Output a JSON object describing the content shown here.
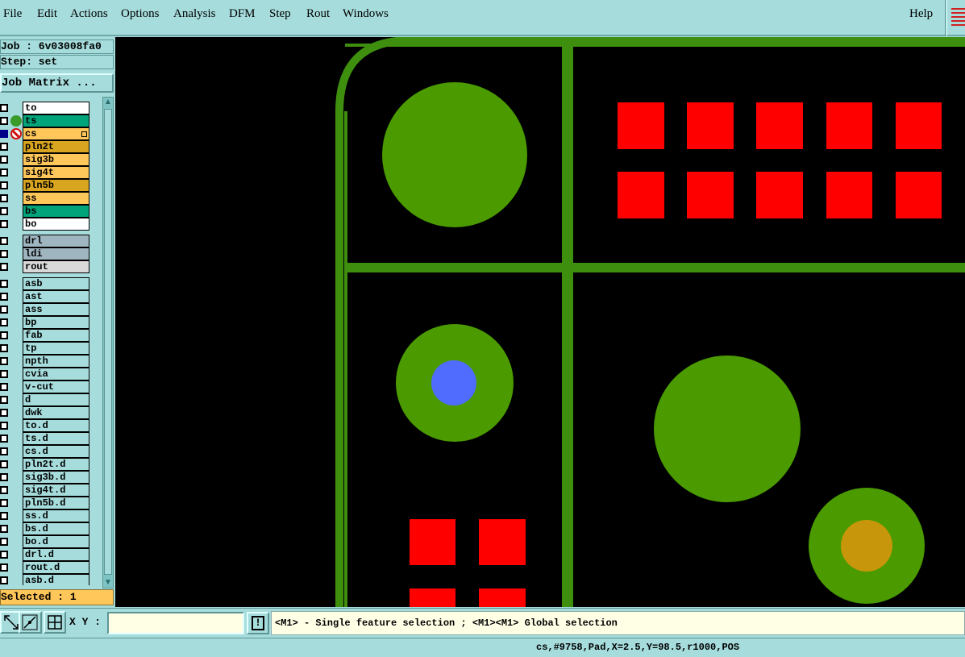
{
  "menu": {
    "file": "File",
    "edit": "Edit",
    "actions": "Actions",
    "options": "Options",
    "analysis": "Analysis",
    "dfm": "DFM",
    "step": "Step",
    "rout": "Rout",
    "windows": "Windows",
    "help": "Help"
  },
  "panel": {
    "job": "Job : 6v03008fa0",
    "step": "Step: set",
    "job_matrix": "Job Matrix ...",
    "selected": "Selected : 1"
  },
  "layers": [
    {
      "name": "to",
      "color": "#ffffff",
      "state": "none"
    },
    {
      "name": "ts",
      "color": "#00a47a",
      "state": "displayed"
    },
    {
      "name": "cs",
      "color": "#ffc659",
      "state": "work"
    },
    {
      "name": "pln2t",
      "color": "#d9a520",
      "state": "none"
    },
    {
      "name": "sig3b",
      "color": "#ffc659",
      "state": "none"
    },
    {
      "name": "sig4t",
      "color": "#ffc659",
      "state": "none"
    },
    {
      "name": "pln5b",
      "color": "#d9a520",
      "state": "none"
    },
    {
      "name": "ss",
      "color": "#ffc659",
      "state": "none"
    },
    {
      "name": "bs",
      "color": "#00a47a",
      "state": "none"
    },
    {
      "name": "bo",
      "color": "#ffffff",
      "state": "none"
    },
    {
      "name": "drl",
      "color": "#9fb5c0",
      "state": "none"
    },
    {
      "name": "ldi",
      "color": "#9fb5c0",
      "state": "none"
    },
    {
      "name": "rout",
      "color": "#d9d9d9",
      "state": "none"
    },
    {
      "name": "asb",
      "color": "#a6dcdc",
      "state": "none"
    },
    {
      "name": "ast",
      "color": "#a6dcdc",
      "state": "none"
    },
    {
      "name": "ass",
      "color": "#a6dcdc",
      "state": "none"
    },
    {
      "name": "bp",
      "color": "#a6dcdc",
      "state": "none"
    },
    {
      "name": "fab",
      "color": "#a6dcdc",
      "state": "none"
    },
    {
      "name": "tp",
      "color": "#a6dcdc",
      "state": "none"
    },
    {
      "name": "npth",
      "color": "#a6dcdc",
      "state": "none"
    },
    {
      "name": "cvia",
      "color": "#a6dcdc",
      "state": "none"
    },
    {
      "name": "v-cut",
      "color": "#a6dcdc",
      "state": "none"
    },
    {
      "name": "d",
      "color": "#a6dcdc",
      "state": "none"
    },
    {
      "name": "dwk",
      "color": "#a6dcdc",
      "state": "none"
    },
    {
      "name": "to.d",
      "color": "#a6dcdc",
      "state": "none"
    },
    {
      "name": "ts.d",
      "color": "#a6dcdc",
      "state": "none"
    },
    {
      "name": "cs.d",
      "color": "#a6dcdc",
      "state": "none"
    },
    {
      "name": "pln2t.d",
      "color": "#a6dcdc",
      "state": "none"
    },
    {
      "name": "sig3b.d",
      "color": "#a6dcdc",
      "state": "none"
    },
    {
      "name": "sig4t.d",
      "color": "#a6dcdc",
      "state": "none"
    },
    {
      "name": "pln5b.d",
      "color": "#a6dcdc",
      "state": "none"
    },
    {
      "name": "ss.d",
      "color": "#a6dcdc",
      "state": "none"
    },
    {
      "name": "bs.d",
      "color": "#a6dcdc",
      "state": "none"
    },
    {
      "name": "bo.d",
      "color": "#a6dcdc",
      "state": "none"
    },
    {
      "name": "drl.d",
      "color": "#a6dcdc",
      "state": "none"
    },
    {
      "name": "rout.d",
      "color": "#a6dcdc",
      "state": "none"
    },
    {
      "name": "asb.d",
      "color": "#a6dcdc",
      "state": "none"
    }
  ],
  "toolbar": {
    "xy_label": "X Y :",
    "xy_value": "",
    "info_glyph": "!",
    "prompt": "<M1> - Single feature selection ; <M1><M1> Global selection"
  },
  "status": {
    "text": "cs,#9758,Pad,X=2.5,Y=98.5,r1000,POS"
  },
  "colors": {
    "background": "#a6dcdc",
    "canvas": "#000000",
    "trace": "#3f8f0f",
    "pad_green": "#4a9a00",
    "pad_red": "#ff0000",
    "drill_blue": "#4f6cff",
    "drill_gold": "#c8960a"
  }
}
